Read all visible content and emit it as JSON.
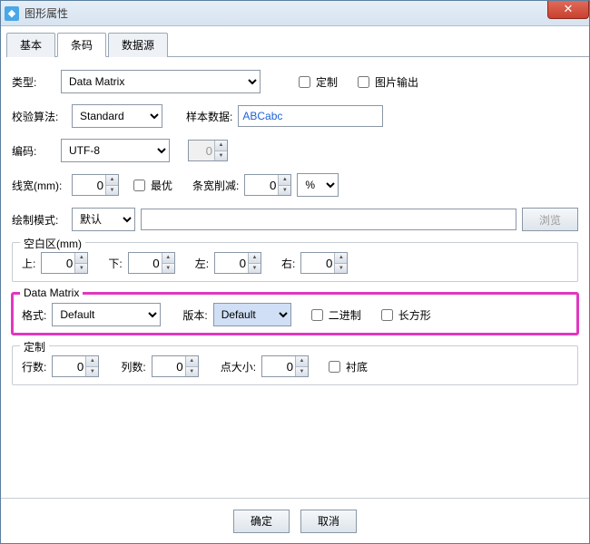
{
  "window": {
    "title": "图形属性"
  },
  "tabs": {
    "basic": "基本",
    "barcode": "条码",
    "datasource": "数据源"
  },
  "type": {
    "label": "类型:",
    "value": "Data Matrix",
    "custom": "定制",
    "image_out": "图片输出"
  },
  "check": {
    "algo_label": "校验算法:",
    "algo_value": "Standard",
    "sample_label": "样本数据:",
    "sample_value": "ABCabc"
  },
  "encoding": {
    "label": "编码:",
    "value": "UTF-8",
    "extra": "0"
  },
  "linewidth": {
    "label": "线宽(mm):",
    "value": "0",
    "optimal": "最优",
    "reduce_label": "条宽削减:",
    "reduce_value": "0",
    "unit": "%"
  },
  "drawmode": {
    "label": "绘制模式:",
    "value": "默认",
    "browse": "浏览"
  },
  "margin": {
    "legend": "空白区(mm)",
    "top_l": "上:",
    "top": "0",
    "bottom_l": "下:",
    "bottom": "0",
    "left_l": "左:",
    "left": "0",
    "right_l": "右:",
    "right": "0"
  },
  "dm": {
    "legend": "Data Matrix",
    "format_l": "格式:",
    "format": "Default",
    "version_l": "版本:",
    "version": "Default",
    "binary": "二进制",
    "rect": "长方形"
  },
  "custom": {
    "legend": "定制",
    "rows_l": "行数:",
    "rows": "0",
    "cols_l": "列数:",
    "cols": "0",
    "dot_l": "点大小:",
    "dot": "0",
    "liner": "衬底"
  },
  "buttons": {
    "ok": "确定",
    "cancel": "取消"
  }
}
